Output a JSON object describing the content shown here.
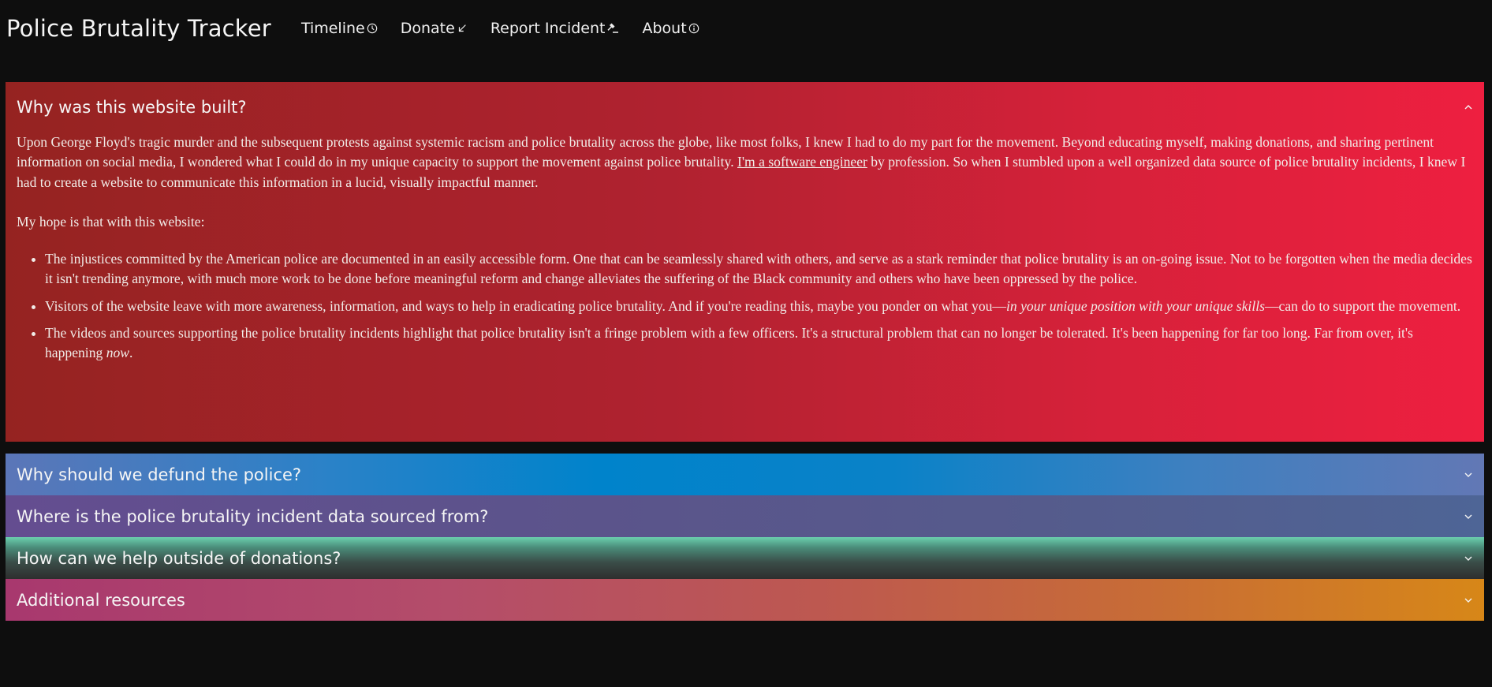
{
  "nav": {
    "brand": "Police Brutality Tracker",
    "links": [
      {
        "label": "Timeline",
        "icon": "clock-icon"
      },
      {
        "label": "Donate",
        "icon": "arrow-down-left-icon"
      },
      {
        "label": "Report Incident",
        "icon": "gavel-icon"
      },
      {
        "label": "About",
        "icon": "info-icon"
      }
    ]
  },
  "faq": {
    "items": [
      {
        "title": "Why was this website built?",
        "expanded": true,
        "color": "#d7213a"
      },
      {
        "title": "Why should we defund the police?",
        "expanded": false,
        "color": "#0083cb"
      },
      {
        "title": "Where is the police brutality incident data sourced from?",
        "expanded": false,
        "color": "#5b548b"
      },
      {
        "title": "How can we help outside of donations?",
        "expanded": false,
        "color": "#6bd0ae"
      },
      {
        "title": "Additional resources",
        "expanded": false,
        "color": "#c86d35"
      }
    ],
    "why": {
      "intro_before_link": "Upon George Floyd's tragic murder and the subsequent protests against systemic racism and police brutality across the globe, like most folks, I knew I had to do my part for the movement. Beyond educating myself, making donations, and sharing pertinent information on social media, I wondered what I could do in my unique capacity to support the movement against police brutality. ",
      "link_text": "I'm a software engineer",
      "intro_after_link": " by profession. So when I stumbled upon a well organized data source of police brutality incidents, I knew I had to create a website to communicate this information in a lucid, visually impactful manner.",
      "hope": "My hope is that with this website:",
      "bullet1": "The injustices committed by the American police are documented in an easily accessible form. One that can be seamlessly shared with others, and serve as a stark reminder that police brutality is an on-going issue. Not to be forgotten when the media decides it isn't trending anymore, with much more work to be done before meaningful reform and change alleviates the suffering of the Black community and others who have been oppressed by the police.",
      "bullet2_a": "Visitors of the website leave with more awareness, information, and ways to help in eradicating police brutality. And if you're reading this, maybe you ponder on what you—",
      "bullet2_em": "in your unique position with your unique skills",
      "bullet2_b": "—can do to support the movement.",
      "bullet3_a": "The videos and sources supporting the police brutality incidents highlight that police brutality isn't a fringe problem with a few officers. It's a structural problem that can no longer be tolerated. It's been happening for far too long. Far from over, it's happening ",
      "bullet3_em": "now",
      "bullet3_b": "."
    }
  }
}
